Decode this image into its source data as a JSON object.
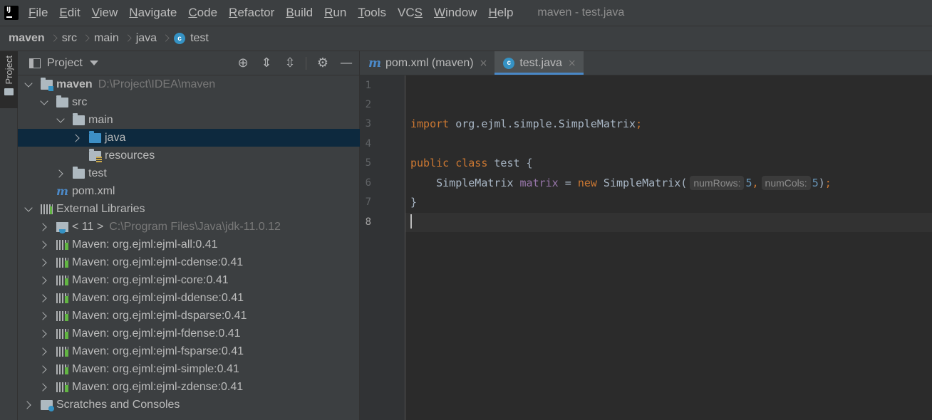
{
  "menubar": {
    "items": [
      {
        "label": "File",
        "mnemonic": "F",
        "rest": "ile"
      },
      {
        "label": "Edit",
        "mnemonic": "E",
        "rest": "dit"
      },
      {
        "label": "View",
        "mnemonic": "V",
        "rest": "iew"
      },
      {
        "label": "Navigate",
        "mnemonic": "N",
        "rest": "avigate"
      },
      {
        "label": "Code",
        "mnemonic": "C",
        "rest": "ode"
      },
      {
        "label": "Refactor",
        "mnemonic": "R",
        "rest": "efactor"
      },
      {
        "label": "Build",
        "mnemonic": "B",
        "rest": "uild"
      },
      {
        "label": "Run",
        "mnemonic": "R",
        "rest": "un"
      },
      {
        "label": "Tools",
        "mnemonic": "T",
        "rest": "ools"
      },
      {
        "label": "VCS",
        "mnemonic": "S",
        "rest": "VC"
      },
      {
        "label": "Window",
        "mnemonic": "W",
        "rest": "indow"
      },
      {
        "label": "Help",
        "mnemonic": "H",
        "rest": "elp"
      }
    ],
    "window_title": "maven - test.java",
    "logo_text": "IJ"
  },
  "breadcrumb": {
    "items": [
      "maven",
      "src",
      "main",
      "java",
      "test"
    ]
  },
  "toolstrip": {
    "project_label": "Project"
  },
  "project_panel": {
    "title": "Project",
    "tools": [
      "locate-icon",
      "expand-all-icon",
      "collapse-all-icon",
      "gear-icon",
      "minimize-icon"
    ],
    "tree": [
      {
        "label": "maven",
        "hint": "D:\\Project\\IDEA\\maven"
      },
      {
        "label": "src"
      },
      {
        "label": "main"
      },
      {
        "label": "java"
      },
      {
        "label": "resources"
      },
      {
        "label": "test"
      },
      {
        "label": "pom.xml"
      },
      {
        "label": "External Libraries"
      },
      {
        "label": "< 11 >",
        "hint": "C:\\Program Files\\Java\\jdk-11.0.12"
      },
      {
        "label": "Maven: org.ejml:ejml-all:0.41"
      },
      {
        "label": "Maven: org.ejml:ejml-cdense:0.41"
      },
      {
        "label": "Maven: org.ejml:ejml-core:0.41"
      },
      {
        "label": "Maven: org.ejml:ejml-ddense:0.41"
      },
      {
        "label": "Maven: org.ejml:ejml-dsparse:0.41"
      },
      {
        "label": "Maven: org.ejml:ejml-fdense:0.41"
      },
      {
        "label": "Maven: org.ejml:ejml-fsparse:0.41"
      },
      {
        "label": "Maven: org.ejml:ejml-simple:0.41"
      },
      {
        "label": "Maven: org.ejml:ejml-zdense:0.41"
      },
      {
        "label": "Scratches and Consoles"
      }
    ]
  },
  "editor": {
    "tabs": [
      {
        "label": "pom.xml (maven)",
        "icon": "m",
        "close": "×"
      },
      {
        "label": "test.java",
        "icon": "c",
        "close": "×"
      }
    ],
    "line_numbers": [
      "1",
      "2",
      "3",
      "4",
      "5",
      "6",
      "7",
      "8"
    ],
    "code": {
      "l3_kw": "import",
      "l3_rest": " org.ejml.simple.SimpleMatrix",
      "l3_semi": ";",
      "l5_kw1": "public",
      "l5_kw2": "class",
      "l5_rest": " test {",
      "l6_type": "    SimpleMatrix ",
      "l6_var": "matrix",
      "l6_eq": " = ",
      "l6_new": "new",
      "l6_call": " SimpleMatrix(",
      "l6_hint1": "numRows:",
      "l6_num1": "5",
      "l6_comma": ",",
      "l6_hint2": "numCols:",
      "l6_num2": "5",
      "l6_close": ")",
      "l6_semi": ";",
      "l7": "}"
    }
  },
  "colors": {
    "keyword": "#cc7832",
    "field": "#9876aa",
    "number": "#6897bb",
    "accent": "#4a88c7",
    "selection": "#0d293e"
  }
}
